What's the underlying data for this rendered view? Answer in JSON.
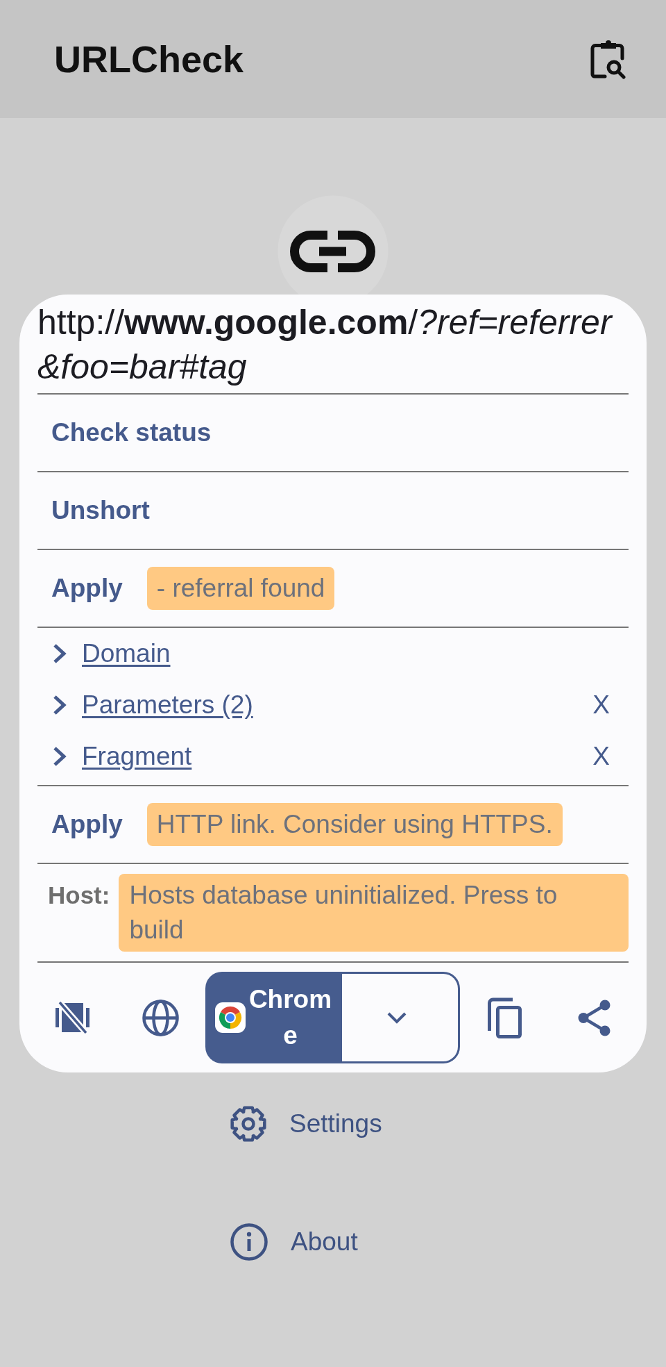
{
  "app_bar": {
    "title": "URLCheck"
  },
  "card": {
    "url": "http://**www.google.com**/*?ref=referrer&foo=bar#tag*",
    "modules": [
      {
        "kind": "button",
        "label": "Check status"
      },
      {
        "kind": "button",
        "label": "Unshort"
      },
      {
        "kind": "apply",
        "button": "Apply",
        "message": "- referral found"
      },
      {
        "kind": "parts",
        "items": [
          {
            "label": "Domain",
            "expanded": false
          },
          {
            "label": "Parameters (2)",
            "expanded": false,
            "remove": "X"
          },
          {
            "label": "Fragment",
            "expanded": false,
            "remove": "X"
          }
        ]
      },
      {
        "kind": "apply",
        "button": "Apply",
        "message": "HTTP link. Consider using HTTPS."
      },
      {
        "kind": "host",
        "label": "Host:",
        "message": "Hosts database uninitialized. Press to build"
      }
    ],
    "toolbar": {
      "browser": "Chrome"
    }
  },
  "menu": [
    {
      "label": "Settings"
    },
    {
      "label": "About"
    }
  ]
}
